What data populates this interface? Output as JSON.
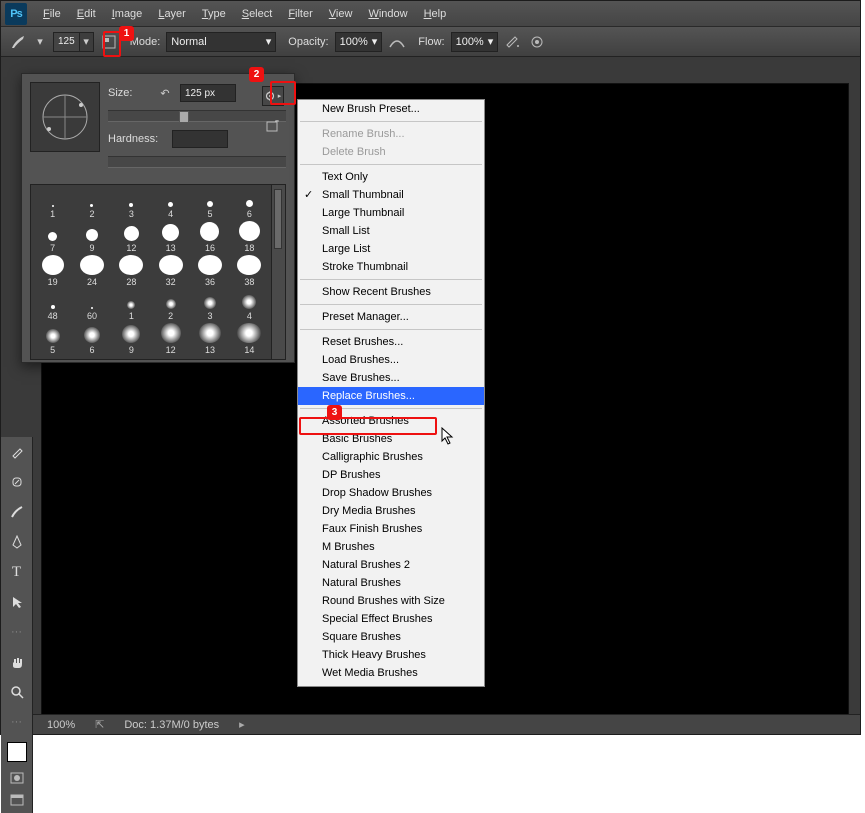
{
  "menubar": {
    "items": [
      "File",
      "Edit",
      "Image",
      "Layer",
      "Type",
      "Select",
      "Filter",
      "View",
      "Window",
      "Help"
    ]
  },
  "options": {
    "brush_size": "125",
    "mode_label": "Mode:",
    "mode_value": "Normal",
    "opacity_label": "Opacity:",
    "opacity_value": "100%",
    "flow_label": "Flow:",
    "flow_value": "100%"
  },
  "brush_panel": {
    "size_label": "Size:",
    "size_value": "125 px",
    "hardness_label": "Hardness:",
    "brushes": [
      {
        "n": "1",
        "d": 2,
        "t": "hard"
      },
      {
        "n": "2",
        "d": 3,
        "t": "hard"
      },
      {
        "n": "3",
        "d": 4,
        "t": "hard"
      },
      {
        "n": "4",
        "d": 5,
        "t": "hard"
      },
      {
        "n": "5",
        "d": 6,
        "t": "hard"
      },
      {
        "n": "6",
        "d": 7,
        "t": "hard"
      },
      {
        "n": "7",
        "d": 9,
        "t": "hard"
      },
      {
        "n": "9",
        "d": 12,
        "t": "hard"
      },
      {
        "n": "12",
        "d": 15,
        "t": "hard"
      },
      {
        "n": "13",
        "d": 17,
        "t": "hard"
      },
      {
        "n": "16",
        "d": 19,
        "t": "hard"
      },
      {
        "n": "18",
        "d": 21,
        "t": "hard"
      },
      {
        "n": "19",
        "d": 22,
        "t": "hard"
      },
      {
        "n": "24",
        "d": 24,
        "t": "hard"
      },
      {
        "n": "28",
        "d": 24,
        "t": "hard"
      },
      {
        "n": "32",
        "d": 24,
        "t": "hard"
      },
      {
        "n": "36",
        "d": 24,
        "t": "hard"
      },
      {
        "n": "38",
        "d": 24,
        "t": "hard"
      },
      {
        "n": "48",
        "d": 4,
        "t": "hard"
      },
      {
        "n": "60",
        "d": 2,
        "t": "hard"
      },
      {
        "n": "1",
        "d": 8,
        "t": "soft"
      },
      {
        "n": "2",
        "d": 10,
        "t": "soft"
      },
      {
        "n": "3",
        "d": 12,
        "t": "soft"
      },
      {
        "n": "4",
        "d": 14,
        "t": "soft"
      },
      {
        "n": "5",
        "d": 14,
        "t": "soft"
      },
      {
        "n": "6",
        "d": 16,
        "t": "soft"
      },
      {
        "n": "9",
        "d": 18,
        "t": "soft"
      },
      {
        "n": "12",
        "d": 20,
        "t": "soft"
      },
      {
        "n": "13",
        "d": 22,
        "t": "soft"
      },
      {
        "n": "14",
        "d": 24,
        "t": "soft"
      }
    ]
  },
  "flyout": {
    "sections": [
      [
        {
          "label": "New Brush Preset..."
        }
      ],
      [
        {
          "label": "Rename Brush...",
          "disabled": true
        },
        {
          "label": "Delete Brush",
          "disabled": true
        }
      ],
      [
        {
          "label": "Text Only"
        },
        {
          "label": "Small Thumbnail",
          "checked": true
        },
        {
          "label": "Large Thumbnail"
        },
        {
          "label": "Small List"
        },
        {
          "label": "Large List"
        },
        {
          "label": "Stroke Thumbnail"
        }
      ],
      [
        {
          "label": "Show Recent Brushes"
        }
      ],
      [
        {
          "label": "Preset Manager..."
        }
      ],
      [
        {
          "label": "Reset Brushes..."
        },
        {
          "label": "Load Brushes..."
        },
        {
          "label": "Save Brushes..."
        },
        {
          "label": "Replace Brushes...",
          "highlight": true
        }
      ],
      [
        {
          "label": "Assorted Brushes"
        },
        {
          "label": "Basic Brushes"
        },
        {
          "label": "Calligraphic Brushes"
        },
        {
          "label": "DP Brushes"
        },
        {
          "label": "Drop Shadow Brushes"
        },
        {
          "label": "Dry Media Brushes"
        },
        {
          "label": "Faux Finish Brushes"
        },
        {
          "label": "M Brushes"
        },
        {
          "label": "Natural Brushes 2"
        },
        {
          "label": "Natural Brushes"
        },
        {
          "label": "Round Brushes with Size"
        },
        {
          "label": "Special Effect Brushes"
        },
        {
          "label": "Square Brushes"
        },
        {
          "label": "Thick Heavy Brushes"
        },
        {
          "label": "Wet Media Brushes"
        }
      ]
    ]
  },
  "status": {
    "zoom": "100%",
    "doc": "Doc: 1.37M/0 bytes"
  },
  "markers": {
    "1": "1",
    "2": "2",
    "3": "3"
  }
}
